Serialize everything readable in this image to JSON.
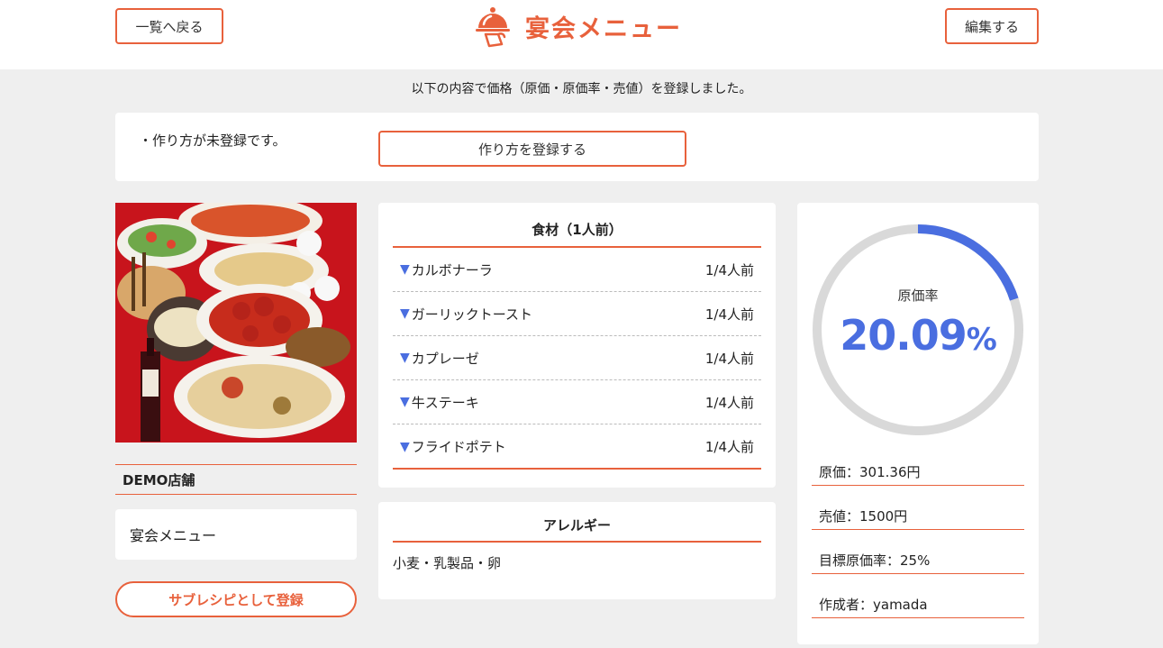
{
  "header": {
    "back_label": "一覧へ戻る",
    "title": "宴会メニュー",
    "edit_label": "編集する"
  },
  "notice": "以下の内容で価格（原価・原価率・売値）を登録しました。",
  "warning": {
    "text": "・作り方が未登録です。",
    "button_label": "作り方を登録する"
  },
  "left": {
    "store_name": "DEMO店舗",
    "menu_name": "宴会メニュー",
    "subrecipe_label": "サブレシピとして登録"
  },
  "ingredients": {
    "title": "食材（1人前）",
    "items": [
      {
        "name": "カルボナーラ",
        "qty": "1/4人前"
      },
      {
        "name": "ガーリックトースト",
        "qty": "1/4人前"
      },
      {
        "name": "カプレーゼ",
        "qty": "1/4人前"
      },
      {
        "name": "牛ステーキ",
        "qty": "1/4人前"
      },
      {
        "name": "フライドポテト",
        "qty": "1/4人前"
      }
    ]
  },
  "allergy": {
    "title": "アレルギー",
    "text": "小麦・乳製品・卵"
  },
  "cost": {
    "gauge_label": "原価率",
    "rate_number": "20.09",
    "rate_unit": "%",
    "rate_fraction": 0.2009,
    "cost_price": "原価：301.36円",
    "selling_price": "売値：1500円",
    "target_rate": "目標原価率：25%",
    "author": "作成者：yamada"
  },
  "colors": {
    "accent": "#e8613c",
    "gauge_fill": "#4a6ee0",
    "gauge_track": "#d9d9d9"
  }
}
